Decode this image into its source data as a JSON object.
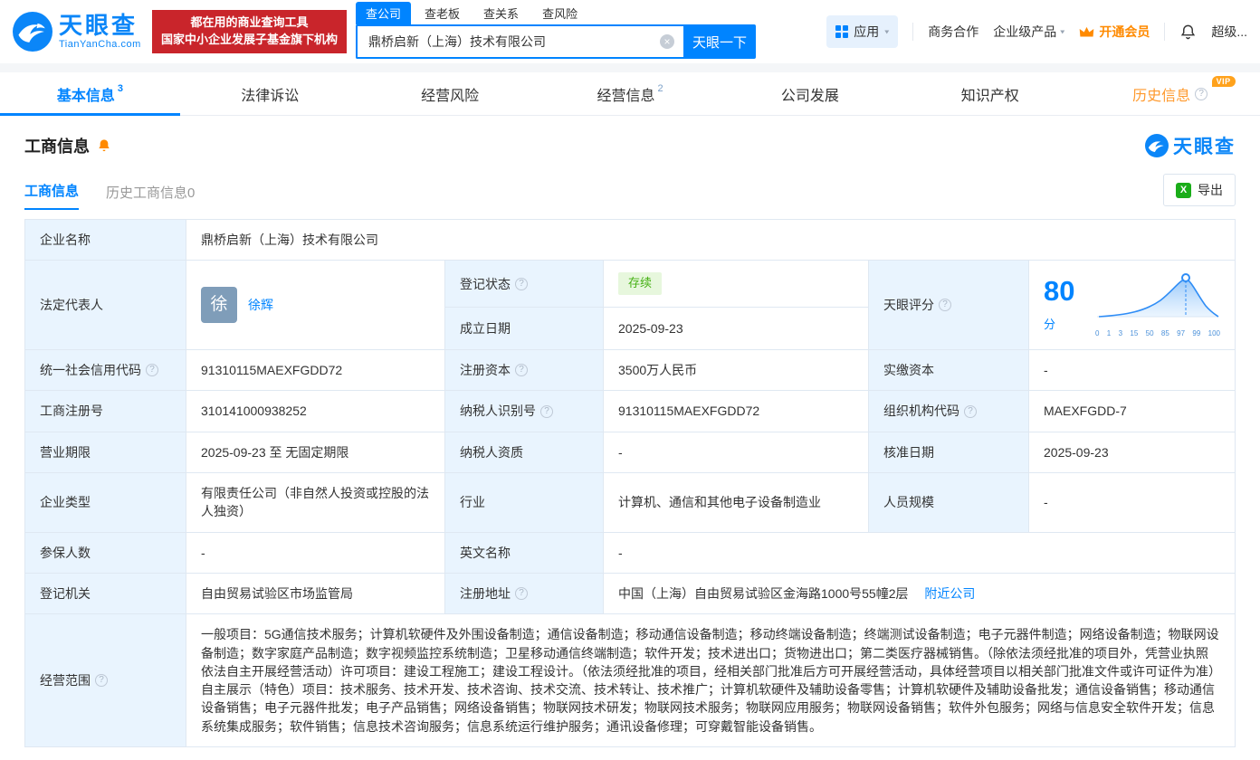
{
  "icons": {
    "clear": "×",
    "caret_down": "▾",
    "question": "?",
    "excel": "X"
  },
  "header": {
    "logo": {
      "brand": "天眼查",
      "domain": "TianYanCha.com"
    },
    "slogan_line1": "都在用的商业查询工具",
    "slogan_line2": "国家中小企业发展子基金旗下机构",
    "search_tabs": [
      {
        "label": "查公司"
      },
      {
        "label": "查老板"
      },
      {
        "label": "查关系"
      },
      {
        "label": "查风险"
      }
    ],
    "search": {
      "value": "鼎桥启新（上海）技术有限公司",
      "button": "天眼一下"
    },
    "nav": {
      "apps": "应用",
      "business": "商务合作",
      "enterprise": "企业级产品",
      "vip": "开通会员",
      "user": "超级..."
    }
  },
  "tabs": [
    {
      "label": "基本信息",
      "badge": "3"
    },
    {
      "label": "法律诉讼",
      "badge": ""
    },
    {
      "label": "经营风险",
      "badge": ""
    },
    {
      "label": "经营信息",
      "badge": "2"
    },
    {
      "label": "公司发展",
      "badge": ""
    },
    {
      "label": "知识产权",
      "badge": ""
    },
    {
      "label": "历史信息",
      "badge": "",
      "vip_tag": "VIP"
    }
  ],
  "section": {
    "title": "工商信息",
    "brand": "天眼查",
    "subtabs": [
      {
        "label": "工商信息"
      },
      {
        "label": "历史工商信息0"
      }
    ],
    "export_label": "导出"
  },
  "info": {
    "company_name": {
      "label": "企业名称",
      "value": "鼎桥启新（上海）技术有限公司"
    },
    "legal_rep": {
      "label": "法定代表人",
      "avatar": "徐",
      "value": "徐辉"
    },
    "reg_status": {
      "label": "登记状态",
      "value": "存续"
    },
    "establish_date": {
      "label": "成立日期",
      "value": "2025-09-23"
    },
    "score": {
      "label": "天眼评分",
      "value": "80",
      "unit": "分",
      "axis": [
        "0",
        "1",
        "3",
        "15",
        "50",
        "85",
        "97",
        "99",
        "100"
      ]
    },
    "credit_code": {
      "label": "统一社会信用代码",
      "value": "91310115MAEXFGDD72"
    },
    "reg_capital": {
      "label": "注册资本",
      "value": "3500万人民币"
    },
    "paid_capital": {
      "label": "实缴资本",
      "value": "-"
    },
    "reg_number": {
      "label": "工商注册号",
      "value": "310141000938252"
    },
    "taxpayer_id": {
      "label": "纳税人识别号",
      "value": "91310115MAEXFGDD72"
    },
    "org_code": {
      "label": "组织机构代码",
      "value": "MAEXFGDD-7"
    },
    "business_term": {
      "label": "营业期限",
      "value": "2025-09-23 至 无固定期限"
    },
    "taxpayer_quality": {
      "label": "纳税人资质",
      "value": "-"
    },
    "approval_date": {
      "label": "核准日期",
      "value": "2025-09-23"
    },
    "company_type": {
      "label": "企业类型",
      "value": "有限责任公司（非自然人投资或控股的法人独资）"
    },
    "industry": {
      "label": "行业",
      "value": "计算机、通信和其他电子设备制造业"
    },
    "staff_size": {
      "label": "人员规模",
      "value": "-"
    },
    "insured_count": {
      "label": "参保人数",
      "value": "-"
    },
    "english_name": {
      "label": "英文名称",
      "value": "-"
    },
    "reg_authority": {
      "label": "登记机关",
      "value": "自由贸易试验区市场监管局"
    },
    "reg_address": {
      "label": "注册地址",
      "value": "中国（上海）自由贸易试验区金海路1000号55幢2层",
      "link": "附近公司"
    },
    "business_scope": {
      "label": "经营范围",
      "value": "一般项目：5G通信技术服务；计算机软硬件及外围设备制造；通信设备制造；移动通信设备制造；移动终端设备制造；终端测试设备制造；电子元器件制造；网络设备制造；物联网设备制造；数字家庭产品制造；数字视频监控系统制造；卫星移动通信终端制造；软件开发；技术进出口；货物进出口；第二类医疗器械销售。（除依法须经批准的项目外，凭营业执照依法自主开展经营活动）许可项目：建设工程施工；建设工程设计。（依法须经批准的项目，经相关部门批准后方可开展经营活动，具体经营项目以相关部门批准文件或许可证件为准）自主展示（特色）项目：技术服务、技术开发、技术咨询、技术交流、技术转让、技术推广；计算机软硬件及辅助设备零售；计算机软硬件及辅助设备批发；通信设备销售；移动通信设备销售；电子元器件批发；电子产品销售；网络设备销售；物联网技术研发；物联网技术服务；物联网应用服务；物联网设备销售；软件外包服务；网络与信息安全软件开发；信息系统集成服务；软件销售；信息技术咨询服务；信息系统运行维护服务；通讯设备修理；可穿戴智能设备销售。"
    }
  }
}
